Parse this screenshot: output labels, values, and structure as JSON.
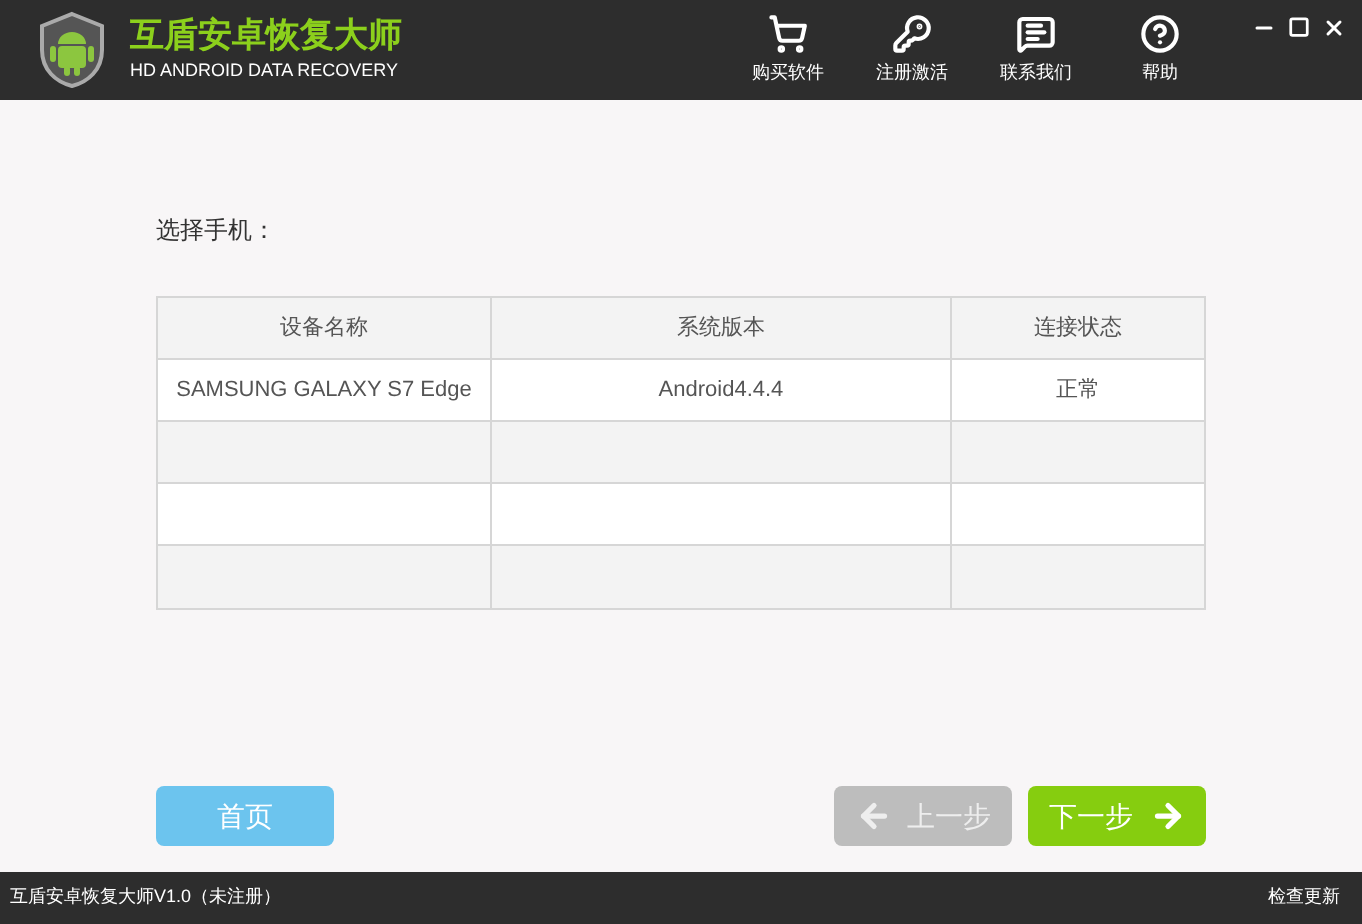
{
  "header": {
    "title": "互盾安卓恢复大师",
    "subtitle": "HD ANDROID DATA RECOVERY"
  },
  "nav": [
    {
      "kind": "cart",
      "label": "购买软件"
    },
    {
      "kind": "key",
      "label": "注册激活"
    },
    {
      "kind": "chat",
      "label": "联系我们"
    },
    {
      "kind": "help",
      "label": "帮助"
    }
  ],
  "prompt": "选择手机：",
  "table": {
    "columns": [
      "设备名称",
      "系统版本",
      "连接状态"
    ],
    "rows": [
      [
        "SAMSUNG  GALAXY S7 Edge",
        "Android4.4.4",
        "正常"
      ],
      [
        "",
        "",
        ""
      ],
      [
        "",
        "",
        ""
      ],
      [
        "",
        "",
        ""
      ]
    ]
  },
  "buttons": {
    "home": {
      "label": "首页",
      "disabled": false
    },
    "prev": {
      "label": "上一步",
      "disabled": true
    },
    "next": {
      "label": "下一步",
      "disabled": false
    }
  },
  "status_bar": {
    "left": "互盾安卓恢复大师V1.0（未注册）",
    "right": "检查更新"
  }
}
